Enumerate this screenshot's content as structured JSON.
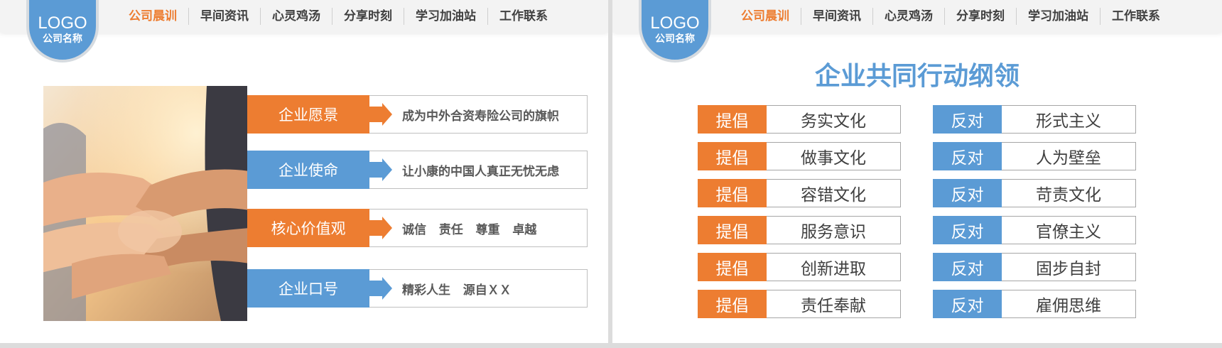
{
  "logo": {
    "line1": "LOGO",
    "line2": "公司名称"
  },
  "nav": [
    "公司晨训",
    "早间资讯",
    "心灵鸡汤",
    "分享时刻",
    "学习加油站",
    "工作联系"
  ],
  "nav_active": 0,
  "left": {
    "rows": [
      {
        "tag": "企业愿景",
        "text": "成为中外合资寿险公司的旗帜",
        "color": "#ed7d31"
      },
      {
        "tag": "企业使命",
        "text": "让小康的中国人真正无忧无虑",
        "color": "#5b9bd5"
      },
      {
        "tag": "核心价值观",
        "text": "诚信   责任   尊重   卓越",
        "color": "#ed7d31"
      },
      {
        "tag": "企业口号",
        "text": "精彩人生   源自ＸＸ",
        "color": "#5b9bd5"
      }
    ]
  },
  "right": {
    "title": "企业共同行动纲领",
    "promote_label": "提倡",
    "oppose_label": "反对",
    "promote": [
      "务实文化",
      "做事文化",
      "容错文化",
      "服务意识",
      "创新进取",
      "责任奉献"
    ],
    "oppose": [
      "形式主义",
      "人为壁垒",
      "苛责文化",
      "官僚主义",
      "固步自封",
      "雇佣思维"
    ]
  },
  "colors": {
    "orange": "#ed7d31",
    "blue": "#5b9bd5"
  }
}
